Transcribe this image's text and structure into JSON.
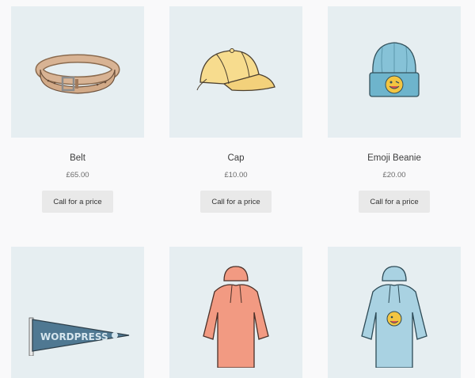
{
  "products": [
    {
      "name": "Belt",
      "price": "£65.00",
      "button_label": "Call for a price",
      "image": "belt-image"
    },
    {
      "name": "Cap",
      "price": "£10.00",
      "button_label": "Call for a price",
      "image": "cap-image"
    },
    {
      "name": "Emoji Beanie",
      "price": "£20.00",
      "button_label": "Call for a price",
      "image": "beanie-image"
    },
    {
      "image": "pennant-image",
      "pennant_text": "WORDPRESS"
    },
    {
      "image": "hoodie-image"
    },
    {
      "image": "hoodie-with-logo-image"
    }
  ],
  "colors": {
    "page_background": "#f9f9fa",
    "image_background": "#e6eef1",
    "button_background": "#e9e9e9"
  }
}
